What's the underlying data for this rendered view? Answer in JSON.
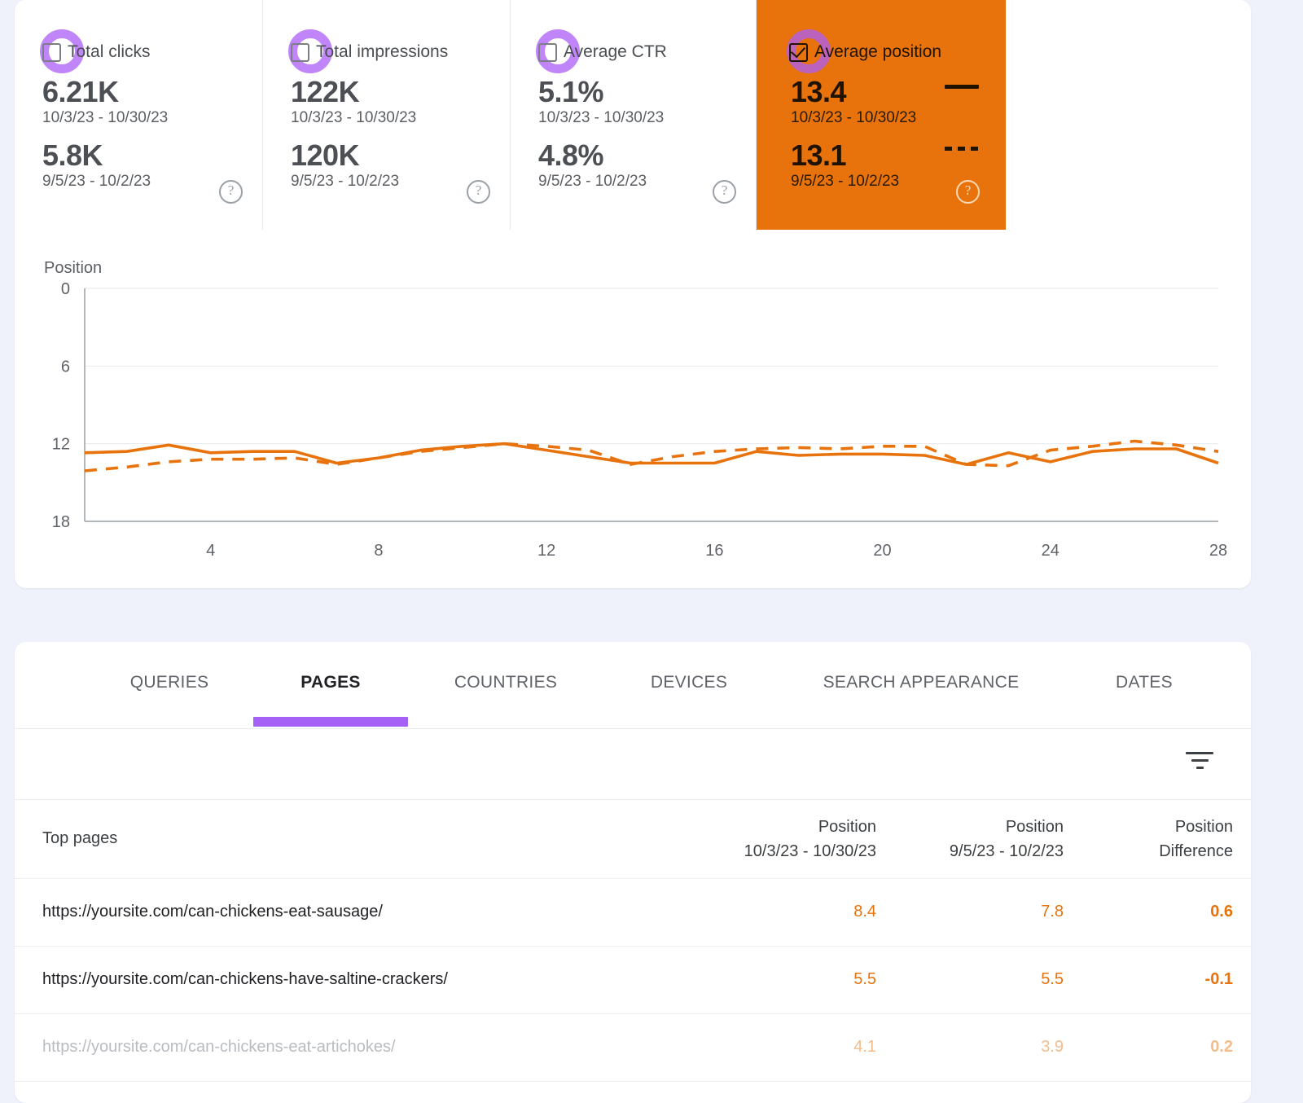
{
  "metrics": [
    {
      "id": "total-clicks",
      "label": "Total clicks",
      "selected": false,
      "value_current": "6.21K",
      "range_current": "10/3/23 - 10/30/23",
      "value_previous": "5.8K",
      "range_previous": "9/5/23 - 10/2/23",
      "help": "?"
    },
    {
      "id": "total-impressions",
      "label": "Total impressions",
      "selected": false,
      "value_current": "122K",
      "range_current": "10/3/23 - 10/30/23",
      "value_previous": "120K",
      "range_previous": "9/5/23 - 10/2/23",
      "help": "?"
    },
    {
      "id": "average-ctr",
      "label": "Average CTR",
      "selected": false,
      "value_current": "5.1%",
      "range_current": "10/3/23 - 10/30/23",
      "value_previous": "4.8%",
      "range_previous": "9/5/23 - 10/2/23",
      "help": "?"
    },
    {
      "id": "average-position",
      "label": "Average position",
      "selected": true,
      "value_current": "13.4",
      "range_current": "10/3/23 - 10/30/23",
      "value_previous": "13.1",
      "range_previous": "9/5/23 - 10/2/23",
      "help": "?"
    }
  ],
  "colors": {
    "accent_orange": "#e8730c",
    "highlight_purple": "#a560f5",
    "page_background": "#eff2fb",
    "card_background": "#ffffff"
  },
  "chart_data": {
    "type": "line",
    "title": "",
    "ylabel": "Position",
    "xlabel": "",
    "ylim": [
      0,
      18
    ],
    "yticks": [
      0,
      6,
      12,
      18
    ],
    "y_inverted": true,
    "xticks": [
      4,
      8,
      12,
      16,
      20,
      24,
      28
    ],
    "x": [
      1,
      2,
      3,
      4,
      5,
      6,
      7,
      8,
      9,
      10,
      11,
      12,
      13,
      14,
      15,
      16,
      17,
      18,
      19,
      20,
      21,
      22,
      23,
      24,
      25,
      26,
      27,
      28
    ],
    "grid": true,
    "legend_position": "in-metric-card",
    "series": [
      {
        "name": "10/3/23 - 10/30/23",
        "style": "solid",
        "color": "#e8730c",
        "values": [
          12.7,
          12.6,
          12.1,
          12.7,
          12.6,
          12.6,
          13.5,
          13.1,
          12.5,
          12.2,
          12.0,
          12.5,
          13.0,
          13.5,
          13.5,
          13.5,
          12.6,
          12.9,
          12.8,
          12.8,
          12.9,
          13.6,
          12.7,
          13.4,
          12.6,
          12.4,
          12.4,
          13.5
        ]
      },
      {
        "name": "9/5/23 - 10/2/23",
        "style": "dashed",
        "color": "#e8730c",
        "values": [
          14.1,
          13.8,
          13.4,
          13.2,
          13.2,
          13.1,
          13.6,
          13.1,
          12.6,
          12.3,
          12.0,
          12.2,
          12.5,
          13.6,
          13.0,
          12.6,
          12.4,
          12.3,
          12.4,
          12.2,
          12.2,
          13.6,
          13.7,
          12.5,
          12.2,
          11.8,
          12.1,
          12.6
        ]
      }
    ]
  },
  "tabs": [
    {
      "label": "QUERIES",
      "active": false
    },
    {
      "label": "PAGES",
      "active": true
    },
    {
      "label": "COUNTRIES",
      "active": false
    },
    {
      "label": "DEVICES",
      "active": false
    },
    {
      "label": "SEARCH APPEARANCE",
      "active": false
    },
    {
      "label": "DATES",
      "active": false
    }
  ],
  "table": {
    "headers": {
      "col0": "Top pages",
      "col1_line1": "Position",
      "col1_line2": "10/3/23 - 10/30/23",
      "col2_line1": "Position",
      "col2_line2": "9/5/23 - 10/2/23",
      "col3_line1": "Position",
      "col3_line2": "Difference"
    },
    "rows": [
      {
        "url": "https://yoursite.com/can-chickens-eat-sausage/",
        "position_current": "8.4",
        "position_previous": "7.8",
        "position_difference": "0.6",
        "faded": false
      },
      {
        "url": "https://yoursite.com/can-chickens-have-saltine-crackers/",
        "position_current": "5.5",
        "position_previous": "5.5",
        "position_difference": "-0.1",
        "faded": false
      },
      {
        "url": "https://yoursite.com/can-chickens-eat-artichokes/",
        "position_current": "4.1",
        "position_previous": "3.9",
        "position_difference": "0.2",
        "faded": true
      }
    ]
  }
}
